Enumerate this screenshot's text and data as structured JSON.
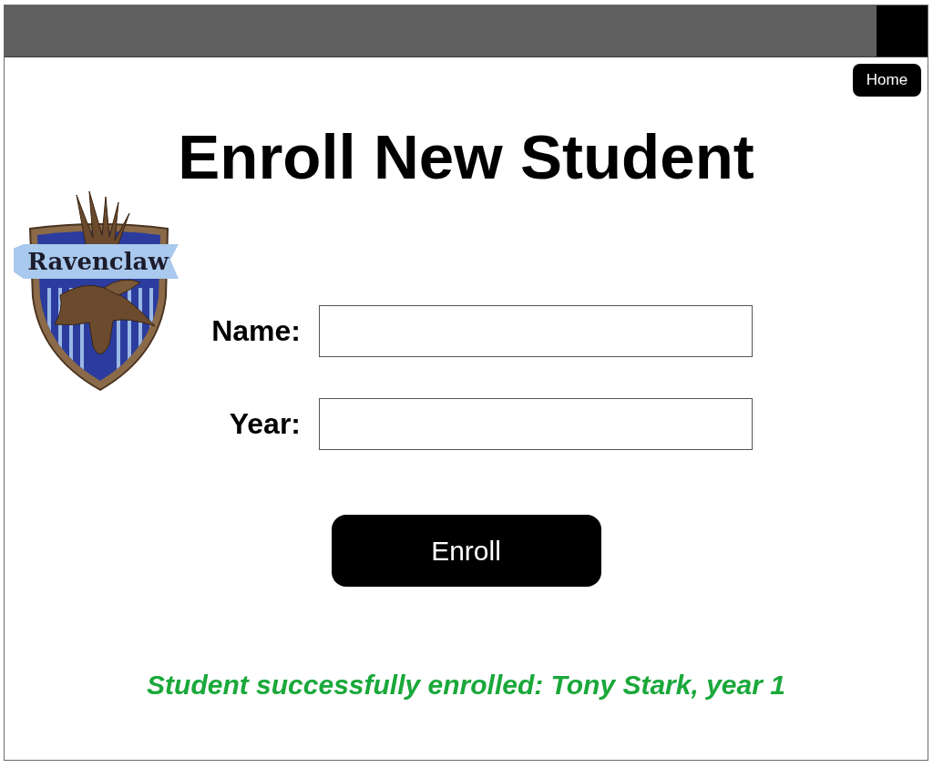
{
  "window": {
    "home_button": "Home"
  },
  "title": "Enroll New Student",
  "crest": {
    "banner": "Ravenclaw"
  },
  "form": {
    "fields": [
      {
        "label": "Name:"
      },
      {
        "label": "Year:"
      }
    ],
    "submit": "Enroll"
  },
  "status_message": {
    "kind": "success",
    "text": "Student successfully enrolled: Tony Stark, year 1"
  }
}
